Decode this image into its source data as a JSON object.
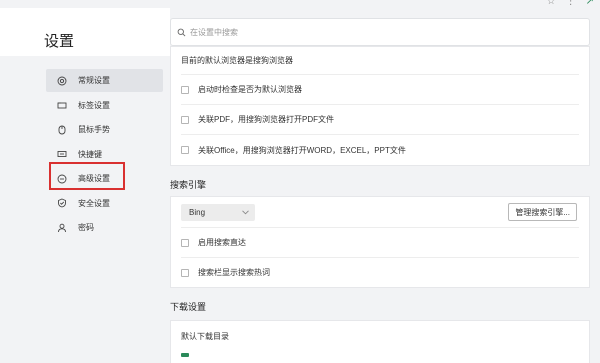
{
  "sidebar": {
    "title": "设置",
    "items": [
      {
        "label": "常规设置",
        "icon": "settings-circle-icon",
        "active": true
      },
      {
        "label": "标签设置",
        "icon": "tab-icon",
        "active": false
      },
      {
        "label": "鼠标手势",
        "icon": "mouse-gesture-icon",
        "active": false
      },
      {
        "label": "快捷键",
        "icon": "shortcut-icon",
        "active": false
      },
      {
        "label": "高级设置",
        "icon": "more-circle-icon",
        "active": false
      },
      {
        "label": "安全设置",
        "icon": "shield-icon",
        "active": false
      },
      {
        "label": "密码",
        "icon": "person-icon",
        "active": false
      }
    ],
    "highlighted_item": "高级设置",
    "highlight_color": "#d93030"
  },
  "search": {
    "placeholder": "在设置中搜索"
  },
  "default_browser": {
    "status_text": "目前的默认浏览器是搜狗浏览器",
    "options": [
      {
        "label": "启动时检查是否为默认浏览器",
        "checked": false
      },
      {
        "label": "关联PDF，用搜狗浏览器打开PDF文件",
        "checked": false
      },
      {
        "label": "关联Office，用搜狗浏览器打开WORD，EXCEL，PPT文件",
        "checked": false
      }
    ]
  },
  "search_engine": {
    "section_title": "搜索引擎",
    "selected_engine": "Bing",
    "manage_button": "管理搜索引擎...",
    "options": [
      {
        "label": "启用搜索直达",
        "checked": false
      },
      {
        "label": "搜索栏显示搜索热词",
        "checked": false
      }
    ]
  },
  "download": {
    "section_title": "下载设置",
    "default_dir_label": "默认下载目录"
  },
  "colors": {
    "accent": "#2a8a5a",
    "active_bg": "#e1e3e7"
  }
}
